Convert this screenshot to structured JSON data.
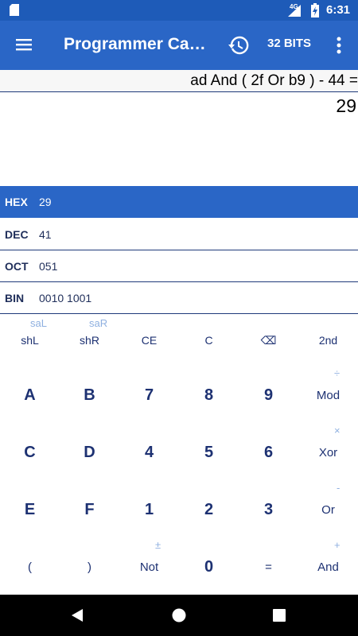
{
  "status_bar": {
    "time": "6:31",
    "network": "4G"
  },
  "app_bar": {
    "title": "Programmer Calculator",
    "bits_label": "32 BITS"
  },
  "display": {
    "expression": "ad And ( 2f Or b9 ) - 44 =",
    "result": "29"
  },
  "bases": [
    {
      "label": "HEX",
      "value": "29",
      "active": true
    },
    {
      "label": "DEC",
      "value": "41",
      "active": false
    },
    {
      "label": "OCT",
      "value": "051",
      "active": false
    },
    {
      "label": "BIN",
      "value": "0010 1001",
      "active": false
    }
  ],
  "keypad": {
    "row1": [
      "shL",
      "shR",
      "CE",
      "C",
      "⌫",
      "2nd"
    ],
    "row1_secondary": [
      "saL",
      "saR"
    ],
    "row2": [
      "A",
      "B",
      "7",
      "8",
      "9",
      "Mod"
    ],
    "row3": [
      "C",
      "D",
      "4",
      "5",
      "6",
      "Xor"
    ],
    "row4": [
      "E",
      "F",
      "1",
      "2",
      "3",
      "Or"
    ],
    "row5": [
      "(",
      ")",
      "Not",
      "0",
      "=",
      "And"
    ],
    "secondary_ops": {
      "mod": "÷",
      "xor": "×",
      "or": "-",
      "not": "±",
      "and": "+"
    }
  },
  "colors": {
    "primary": "#2a66c6",
    "status": "#1e5bb8",
    "key_text": "#1d3172",
    "secondary_text": "#8fb0e0"
  }
}
